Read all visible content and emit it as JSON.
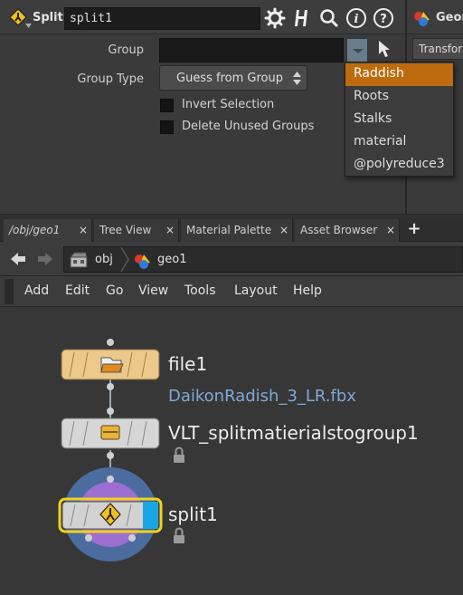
{
  "param_pane": {
    "node_type": "Split",
    "node_name": "split1",
    "group_label": "Group",
    "group_value": "",
    "group_type_label": "Group Type",
    "group_type_value": "Guess from Group",
    "invert_selection_label": "Invert Selection",
    "invert_selection_checked": false,
    "delete_unused_label": "Delete Unused Groups",
    "delete_unused_checked": false
  },
  "right_pane": {
    "title": "Geon",
    "tab": "Transfor"
  },
  "group_menu": {
    "items": [
      "Raddish",
      "Roots",
      "Stalks",
      "material",
      "@polyreduce3"
    ],
    "selected_index": 0
  },
  "tabs": [
    {
      "label": "/obj/geo1",
      "active": true
    },
    {
      "label": "Tree View",
      "active": false
    },
    {
      "label": "Material Palette",
      "active": false
    },
    {
      "label": "Asset Browser",
      "active": false
    }
  ],
  "tab_close_glyph": "×",
  "add_tab_glyph": "+",
  "path": {
    "obj": "obj",
    "geo": "geo1"
  },
  "menu_bar": [
    "Add",
    "Edit",
    "Go",
    "View",
    "Tools",
    "Layout",
    "Help"
  ],
  "nodes": [
    {
      "name": "file1",
      "sublabel": "DaikonRadish_3_LR.fbx",
      "color": "#ecc98a"
    },
    {
      "name": "VLT_splitmatierialstogroup1",
      "color": "#d6d6d6"
    },
    {
      "name": "split1",
      "color": "#d2d2d2",
      "selected": true,
      "display_flag": true
    }
  ],
  "colors": {
    "accent_orange": "#bd6b0e",
    "display_flag_blue": "#1aa6e6",
    "selection_yellow": "#f2d21a",
    "link_blue": "#7ea9d8"
  }
}
